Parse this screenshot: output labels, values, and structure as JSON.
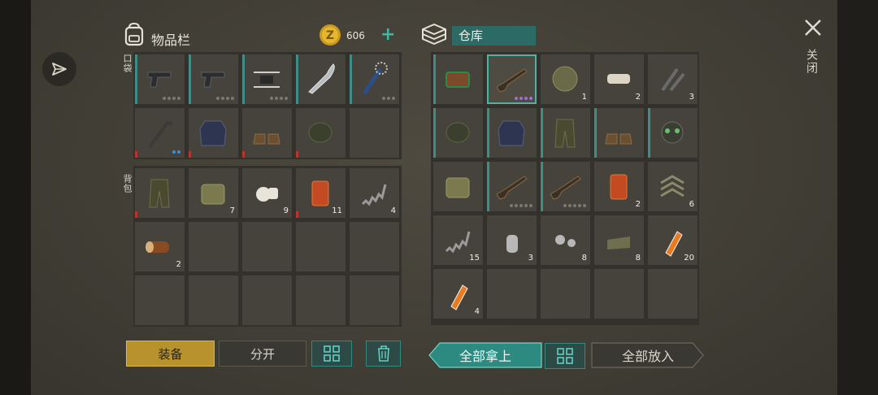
{
  "inventory": {
    "title": "物品栏",
    "pocket_label": "口袋",
    "backpack_label": "背包"
  },
  "currency": {
    "amount": "606",
    "plus": "+"
  },
  "storage": {
    "title": "仓库"
  },
  "close": {
    "label": "关闭"
  },
  "buttons": {
    "equip": "装备",
    "split": "分开",
    "take_all": "全部拿上",
    "put_all": "全部放入"
  },
  "pocket_items": [
    {
      "name": "pistol",
      "qty": "",
      "dots": 4,
      "dot_color": "gray",
      "bar": "teal"
    },
    {
      "name": "pistol",
      "qty": "",
      "dots": 4,
      "dot_color": "gray",
      "bar": "teal"
    },
    {
      "name": "drone",
      "qty": "",
      "dots": 4,
      "dot_color": "gray",
      "bar": "teal"
    },
    {
      "name": "machete",
      "qty": "",
      "dots": 0,
      "dot_color": "",
      "bar": "teal"
    },
    {
      "name": "spiked club",
      "qty": "",
      "dots": 3,
      "dot_color": "gray",
      "bar": "teal"
    },
    {
      "name": "crowbar",
      "qty": "",
      "dots": 2,
      "dot_color": "blue",
      "bar": "red"
    },
    {
      "name": "tactical vest",
      "qty": "",
      "dots": 0,
      "dot_color": "",
      "bar": "red"
    },
    {
      "name": "boots",
      "qty": "",
      "dots": 0,
      "dot_color": "",
      "bar": "red"
    },
    {
      "name": "cap and goggles",
      "qty": "",
      "dots": 0,
      "dot_color": "",
      "bar": "red"
    }
  ],
  "backpack_items": [
    {
      "name": "camo pants",
      "qty": "",
      "bar": "red"
    },
    {
      "name": "medkit",
      "qty": "7",
      "bar": ""
    },
    {
      "name": "bandage",
      "qty": "9",
      "bar": ""
    },
    {
      "name": "canned food",
      "qty": "11",
      "bar": "red"
    },
    {
      "name": "spring",
      "qty": "4",
      "bar": ""
    },
    {
      "name": "log",
      "qty": "2",
      "bar": ""
    }
  ],
  "storage_items": [
    {
      "name": "explosive",
      "qty": "",
      "dots": 0,
      "dot_color": "",
      "bar": "teal"
    },
    {
      "name": "shotgun",
      "qty": "",
      "dots": 4,
      "dot_color": "purple",
      "bar": "",
      "selected": true
    },
    {
      "name": "landmine",
      "qty": "1",
      "dots": 0,
      "dot_color": "",
      "bar": ""
    },
    {
      "name": "pad",
      "qty": "2",
      "dots": 0,
      "dot_color": "",
      "bar": ""
    },
    {
      "name": "tools",
      "qty": "3",
      "dots": 0,
      "dot_color": "",
      "bar": ""
    },
    {
      "name": "balaclava",
      "qty": "",
      "dots": 0,
      "dot_color": "",
      "bar": "teal"
    },
    {
      "name": "ghillie jacket",
      "qty": "",
      "dots": 0,
      "dot_color": "",
      "bar": "teal"
    },
    {
      "name": "camo pants",
      "qty": "",
      "dots": 0,
      "dot_color": "",
      "bar": "teal"
    },
    {
      "name": "military boots",
      "qty": "",
      "dots": 0,
      "dot_color": "",
      "bar": "teal"
    },
    {
      "name": "gas mask",
      "qty": "",
      "dots": 0,
      "dot_color": "",
      "bar": "teal"
    },
    {
      "name": "backpack",
      "qty": "",
      "dots": 0,
      "dot_color": "",
      "bar": ""
    },
    {
      "name": "shotgun",
      "qty": "",
      "dots": 5,
      "dot_color": "gray",
      "bar": "teal"
    },
    {
      "name": "assault rifle",
      "qty": "",
      "dots": 5,
      "dot_color": "gray",
      "bar": "teal"
    },
    {
      "name": "jerry can",
      "qty": "2",
      "dots": 0,
      "dot_color": "",
      "bar": ""
    },
    {
      "name": "rank patch",
      "qty": "6",
      "dots": 0,
      "dot_color": "",
      "bar": ""
    },
    {
      "name": "spring",
      "qty": "15",
      "dots": 0,
      "dot_color": "",
      "bar": ""
    },
    {
      "name": "dog tag",
      "qty": "3",
      "dots": 0,
      "dot_color": "",
      "bar": ""
    },
    {
      "name": "bolt and nut",
      "qty": "8",
      "dots": 0,
      "dot_color": "",
      "bar": ""
    },
    {
      "name": "fabric",
      "qty": "8",
      "dots": 0,
      "dot_color": "",
      "bar": ""
    },
    {
      "name": "glue",
      "qty": "20",
      "dots": 0,
      "dot_color": "",
      "bar": ""
    },
    {
      "name": "glue",
      "qty": "4",
      "dots": 0,
      "dot_color": "",
      "bar": ""
    }
  ],
  "colors": {
    "accent": "#4db3a3",
    "equip": "#b8922c",
    "warning": "#b8362f"
  }
}
